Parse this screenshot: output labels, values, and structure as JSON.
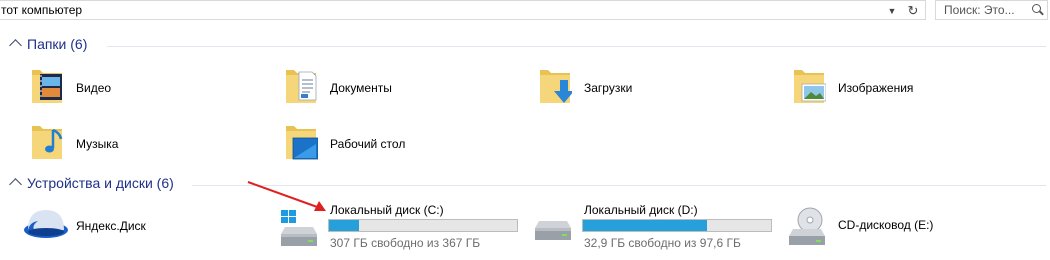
{
  "address_bar": {
    "path": "тот компьютер"
  },
  "search": {
    "placeholder": "Поиск: Это..."
  },
  "folders_group": {
    "title": "Папки (6)"
  },
  "folders": [
    {
      "label": "Видео"
    },
    {
      "label": "Документы"
    },
    {
      "label": "Загрузки"
    },
    {
      "label": "Изображения"
    },
    {
      "label": "Музыка"
    },
    {
      "label": "Рабочий стол"
    }
  ],
  "devices_group": {
    "title": "Устройства и диски (6)"
  },
  "devices": [
    {
      "label": "Яндекс.Диск"
    },
    {
      "label": "Локальный диск (C:)",
      "free_text": "307 ГБ свободно из 367 ГБ",
      "used_fraction": 0.16
    },
    {
      "label": "Локальный диск (D:)",
      "free_text": "32,9 ГБ свободно из 97,6 ГБ",
      "used_fraction": 0.66
    },
    {
      "label": "CD-дисковод (E:)"
    }
  ],
  "colors": {
    "accent_bar": "#26a0da",
    "group_title": "#1e3287",
    "annotation_arrow": "#e02020"
  }
}
